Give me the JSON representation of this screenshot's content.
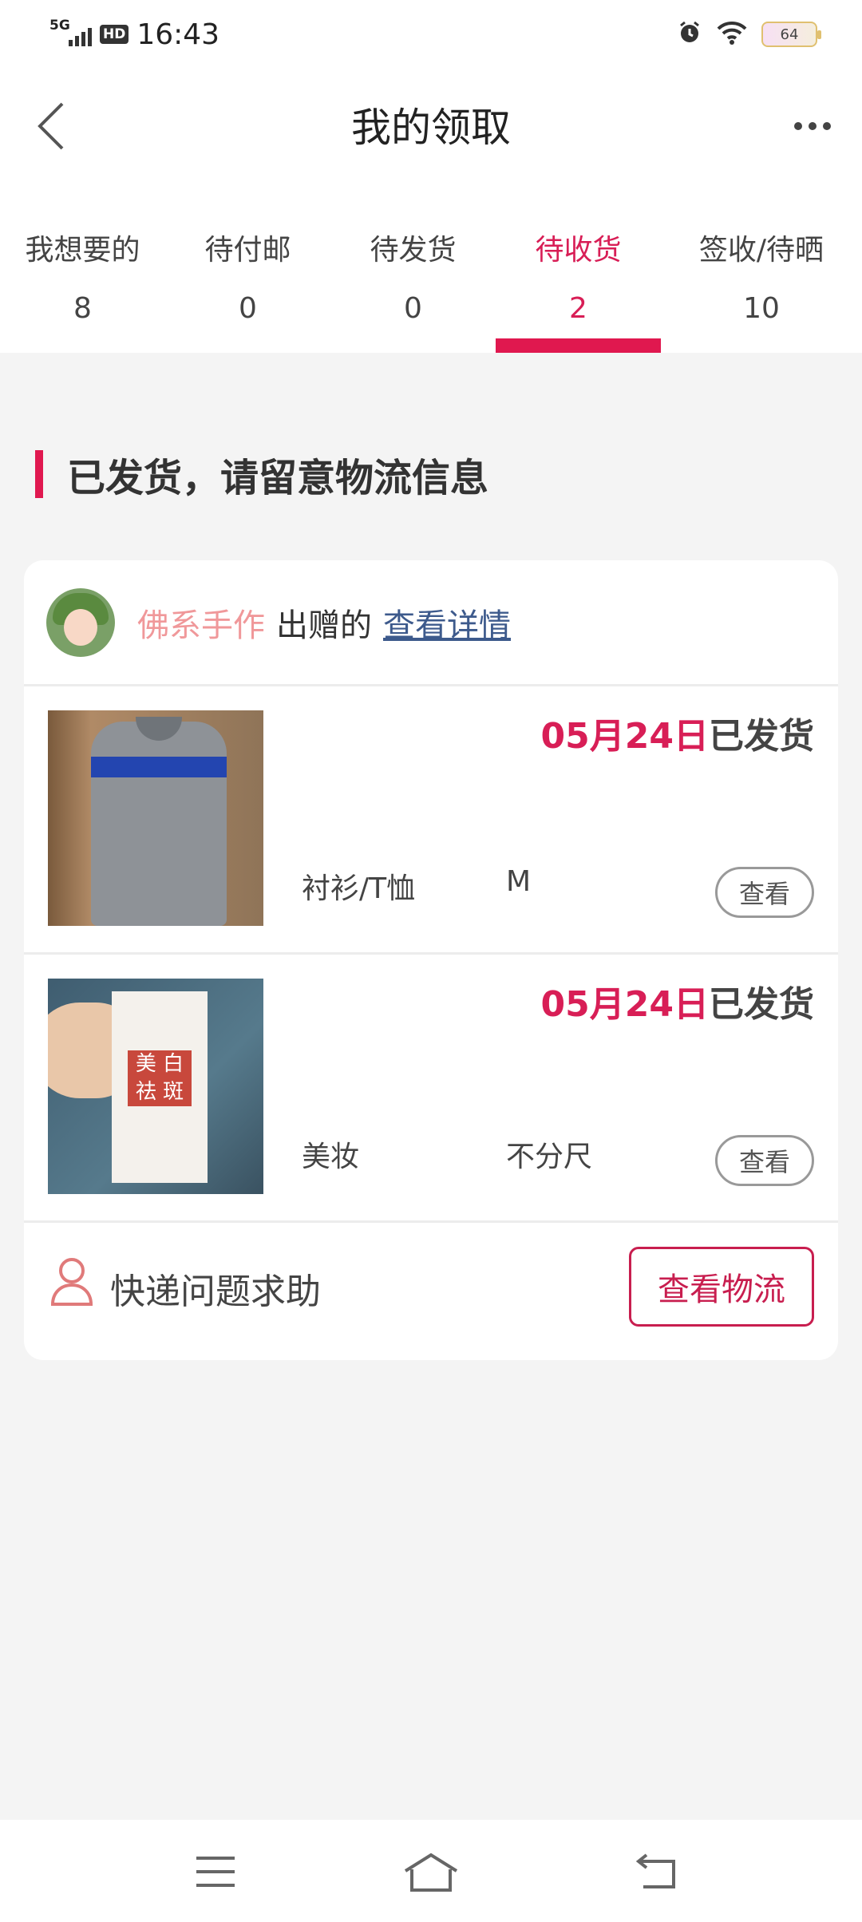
{
  "status_bar": {
    "time": "16:43",
    "network": "5G",
    "hd": "HD",
    "battery": "64"
  },
  "header": {
    "title": "我的领取"
  },
  "tabs": [
    {
      "label": "我想要的",
      "count": "8",
      "active": false
    },
    {
      "label": "待付邮",
      "count": "0",
      "active": false
    },
    {
      "label": "待发货",
      "count": "0",
      "active": false
    },
    {
      "label": "待收货",
      "count": "2",
      "active": true
    },
    {
      "label": "签收/待晒",
      "count": "10",
      "active": false
    }
  ],
  "section": {
    "title": "已发货，请留意物流信息"
  },
  "card": {
    "giver": "佛系手作",
    "given_text": "出赠的",
    "detail_link": "查看详情",
    "items": [
      {
        "date": "05月24日",
        "status": "已发货",
        "category": "衬衫/T恤",
        "size": "M",
        "view_label": "查看"
      },
      {
        "date": "05月24日",
        "status": "已发货",
        "category": "美妆",
        "size": "不分尺",
        "view_label": "查看"
      }
    ],
    "help_text": "快递问题求助",
    "logistics_button": "查看物流"
  },
  "colors": {
    "accent": "#e0184f",
    "giver_name": "#f0989a",
    "link": "#3d5a8c"
  }
}
